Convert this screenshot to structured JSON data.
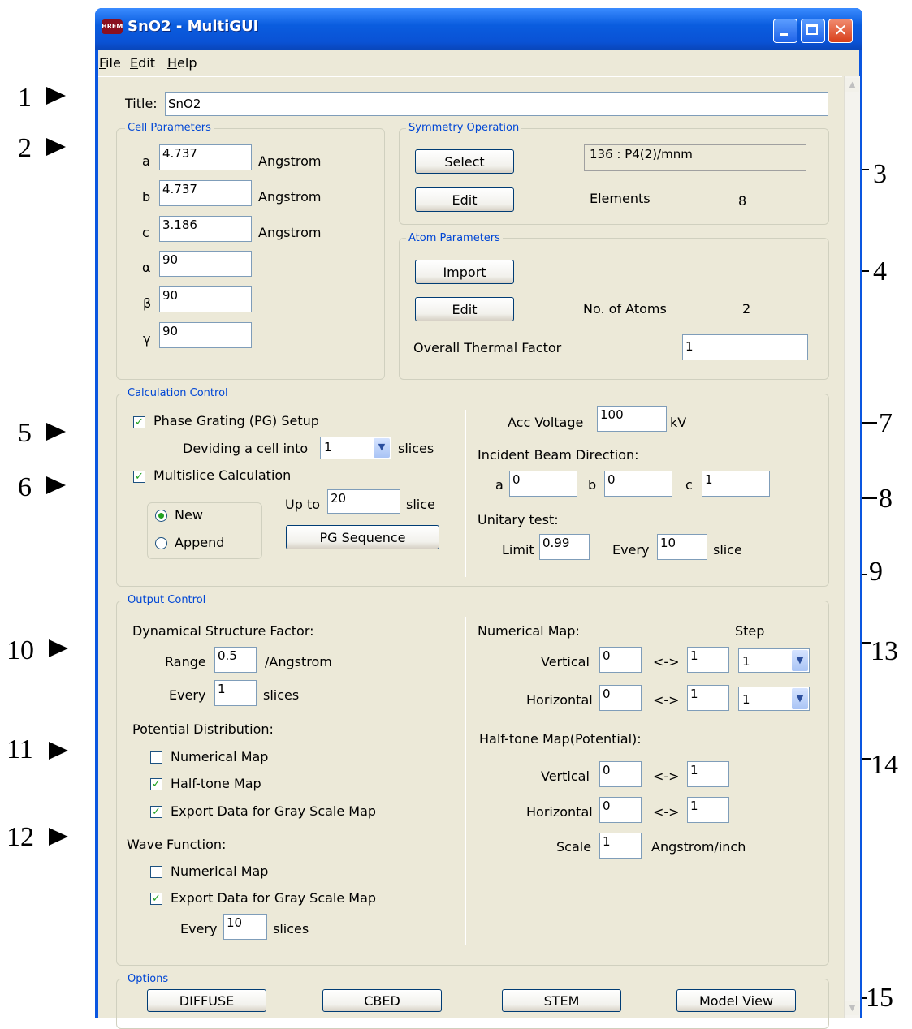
{
  "window": {
    "title": "SnO2 - MultiGUI",
    "icon_text": "HREM"
  },
  "menu": [
    {
      "u": "F",
      "rest": "ile"
    },
    {
      "u": "E",
      "rest": "dit"
    },
    {
      "u": "H",
      "rest": "elp"
    }
  ],
  "callouts": [
    "1",
    "2",
    "3",
    "4",
    "5",
    "6",
    "7",
    "8",
    "9",
    "10",
    "11",
    "12",
    "13",
    "14",
    "15"
  ],
  "title_field": {
    "label": "Title:",
    "value": "SnO2"
  },
  "cell": {
    "group": "Cell Parameters",
    "rows": [
      {
        "label": "a",
        "value": "4.737",
        "unit": "Angstrom"
      },
      {
        "label": "b",
        "value": "4.737",
        "unit": "Angstrom"
      },
      {
        "label": "c",
        "value": "3.186",
        "unit": "Angstrom"
      },
      {
        "label": "α",
        "value": "90",
        "unit": ""
      },
      {
        "label": "β",
        "value": "90",
        "unit": ""
      },
      {
        "label": "γ",
        "value": "90",
        "unit": ""
      }
    ]
  },
  "symmetry": {
    "group": "Symmetry Operation",
    "select": "Select",
    "edit": "Edit",
    "space_group": "136 : P4(2)/mnm",
    "elements_label": "Elements",
    "elements_value": "8"
  },
  "atoms": {
    "group": "Atom Parameters",
    "import": "Import",
    "edit": "Edit",
    "count_label": "No. of Atoms",
    "count_value": "2",
    "thermal_label": "Overall Thermal Factor",
    "thermal_value": "1"
  },
  "calc": {
    "group": "Calculation Control",
    "pg_setup": "Phase Grating (PG) Setup",
    "dividing": "Deviding a cell into",
    "slices_value": "1",
    "slices": "slices",
    "multislice": "Multislice Calculation",
    "new": "New",
    "append": "Append",
    "up_to": "Up to",
    "up_to_value": "20",
    "slice": "slice",
    "pg_sequence": "PG Sequence",
    "acc_voltage": "Acc Voltage",
    "acc_value": "100",
    "kv": "kV",
    "incident": "Incident Beam Direction:",
    "dir_a": "a",
    "dir_a_val": "0",
    "dir_b": "b",
    "dir_b_val": "0",
    "dir_c": "c",
    "dir_c_val": "1",
    "unitary": "Unitary test:",
    "limit": "Limit",
    "limit_val": "0.99",
    "every": "Every",
    "every_val": "10",
    "slice2": "slice"
  },
  "output": {
    "group": "Output Control",
    "dsf": "Dynamical Structure Factor:",
    "range": "Range",
    "range_val": "0.5",
    "per_angstrom": "/Angstrom",
    "every": "Every",
    "every_val": "1",
    "slices": "slices",
    "potential": "Potential Distribution:",
    "numerical_map": "Numerical Map",
    "halftone_map": "Half-tone Map",
    "export_gray": "Export Data for Gray Scale Map",
    "wave": "Wave Function:",
    "wave_numerical": "Numerical Map",
    "wave_export": "Export Data for Gray Scale Map",
    "wave_every": "Every",
    "wave_every_val": "10",
    "wave_slices": "slices",
    "num_map": "Numerical Map:",
    "step": "Step",
    "vertical": "Vertical",
    "horizontal": "Horizontal",
    "arrow": "<->",
    "nm_v_from": "0",
    "nm_v_to": "1",
    "nm_v_step": "1",
    "nm_h_from": "0",
    "nm_h_to": "1",
    "nm_h_step": "1",
    "halftone": "Half-tone Map(Potential):",
    "ht_v_from": "0",
    "ht_v_to": "1",
    "ht_h_from": "0",
    "ht_h_to": "1",
    "scale": "Scale",
    "scale_val": "1",
    "scale_unit": "Angstrom/inch"
  },
  "options": {
    "group": "Options",
    "buttons": [
      "DIFFUSE",
      "CBED",
      "STEM",
      "Model View"
    ]
  }
}
